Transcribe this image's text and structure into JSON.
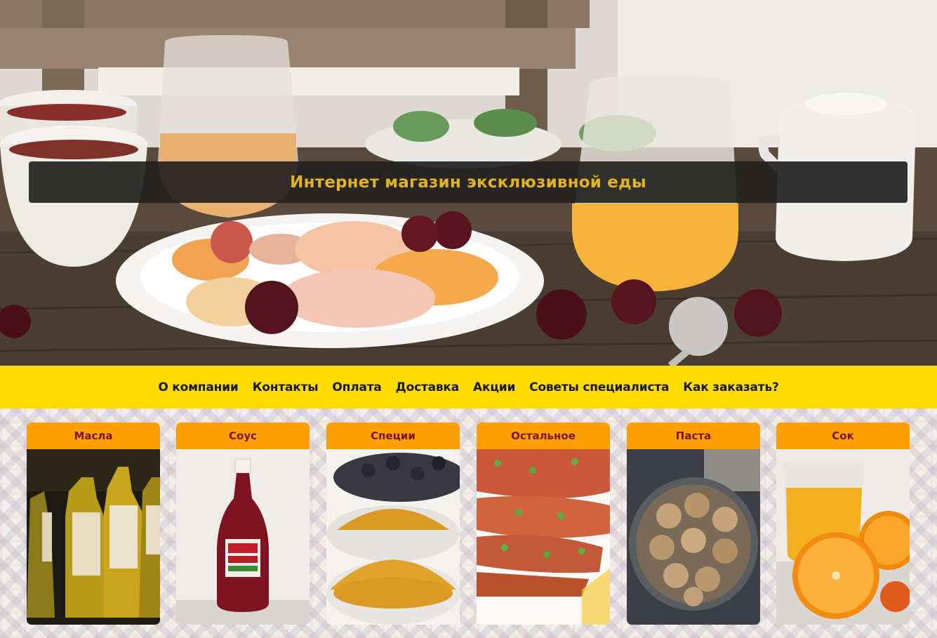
{
  "hero": {
    "title": "Интернет магазин эксклюзивной еды"
  },
  "nav": {
    "items": [
      {
        "label": "О компании"
      },
      {
        "label": "Контакты"
      },
      {
        "label": "Оплата"
      },
      {
        "label": "Доставка"
      },
      {
        "label": "Акции"
      },
      {
        "label": "Советы специалиста"
      },
      {
        "label": "Как заказать?"
      }
    ]
  },
  "categories": [
    {
      "label": "Масла",
      "image": "olive-oil-bottles-image"
    },
    {
      "label": "Соус",
      "image": "ketchup-bottle-image"
    },
    {
      "label": "Специи",
      "image": "spice-bowls-image"
    },
    {
      "label": "Остальное",
      "image": "grilled-chicken-image"
    },
    {
      "label": "Паста",
      "image": "pasta-jar-image"
    },
    {
      "label": "Сок",
      "image": "orange-juice-image"
    }
  ],
  "colors": {
    "nav_background": "#ffdc00",
    "card_header": "#ffa000",
    "card_label": "#7a1414",
    "title_text": "#e2b320",
    "title_bar": "#222222"
  }
}
